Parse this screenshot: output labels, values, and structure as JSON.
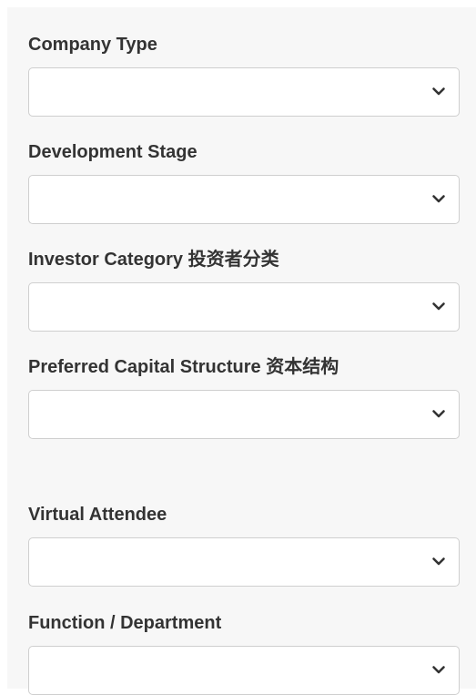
{
  "form": {
    "fields": [
      {
        "label": "Company Type",
        "value": ""
      },
      {
        "label": "Development Stage",
        "value": ""
      },
      {
        "label": "Investor Category 投资者分类",
        "value": ""
      },
      {
        "label": "Preferred Capital Structure 资本结构",
        "value": ""
      },
      {
        "label": "Virtual Attendee",
        "value": ""
      },
      {
        "label": "Function / Department",
        "value": ""
      }
    ]
  },
  "icons": {
    "dropdown": "chevron-down-icon"
  },
  "colors": {
    "panel_background": "#f7f7f7",
    "label_text": "#333333",
    "select_border": "#cfcfcf",
    "chevron": "#333333"
  }
}
